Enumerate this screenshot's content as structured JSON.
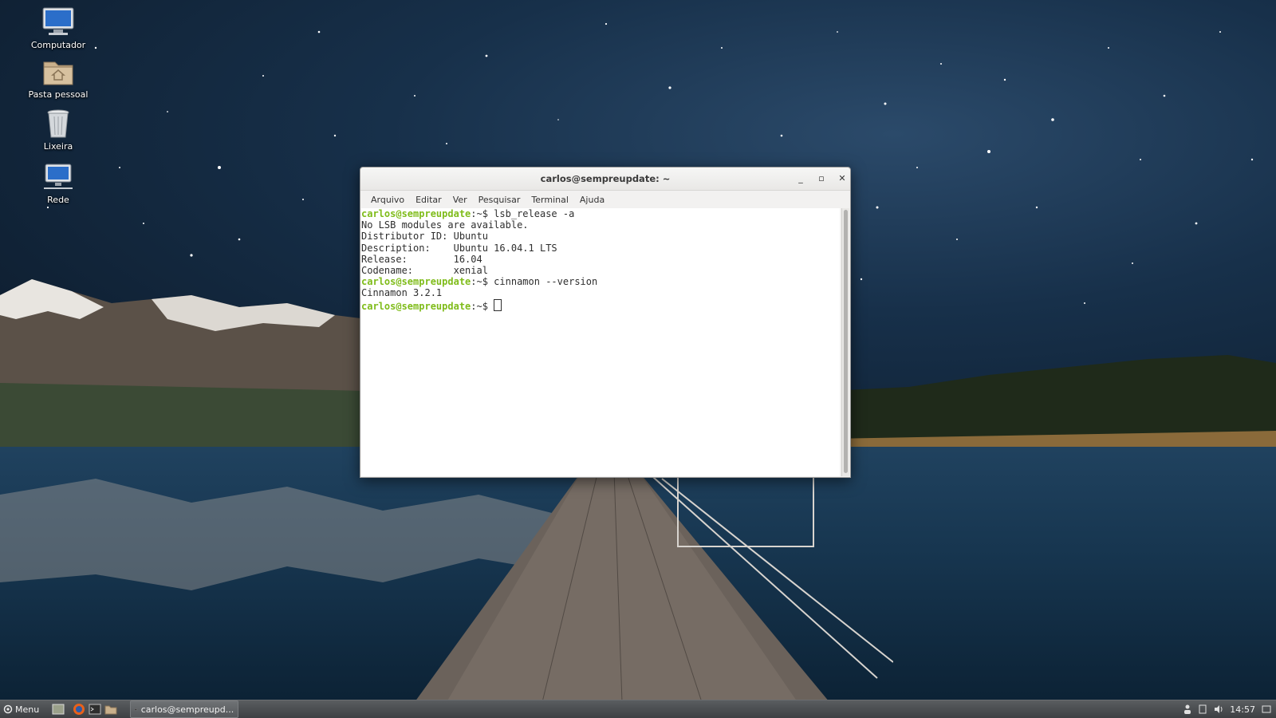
{
  "desktop": {
    "icons": [
      {
        "label": "Computador",
        "icon": "computer-icon"
      },
      {
        "label": "Pasta pessoal",
        "icon": "home-folder-icon"
      },
      {
        "label": "Lixeira",
        "icon": "trash-icon"
      },
      {
        "label": "Rede",
        "icon": "network-icon"
      }
    ]
  },
  "terminal": {
    "title": "carlos@sempreupdate: ~",
    "menu": [
      "Arquivo",
      "Editar",
      "Ver",
      "Pesquisar",
      "Terminal",
      "Ajuda"
    ],
    "prompt": "carlos@sempreupdate",
    "lines": [
      {
        "prompt": "carlos@sempreupdate",
        "cmd": ":~$ lsb_release -a"
      },
      {
        "text": "No LSB modules are available."
      },
      {
        "text": "Distributor ID:\tUbuntu"
      },
      {
        "text": "Description:\tUbuntu 16.04.1 LTS"
      },
      {
        "text": "Release:\t16.04"
      },
      {
        "text": "Codename:\txenial"
      },
      {
        "prompt": "carlos@sempreupdate",
        "cmd": ":~$ cinnamon --version"
      },
      {
        "text": "Cinnamon 3.2.1"
      },
      {
        "prompt": "carlos@sempreupdate",
        "cmd": ":~$ "
      }
    ]
  },
  "taskbar": {
    "menu_label": "Menu",
    "task_label": "carlos@sempreupd...",
    "clock": "14:57",
    "launchers": [
      "show-desktop-icon",
      "firefox-icon",
      "terminal-icon",
      "files-icon"
    ]
  },
  "colors": {
    "prompt": "#7fbc1a",
    "panel": "#4a4d50"
  }
}
